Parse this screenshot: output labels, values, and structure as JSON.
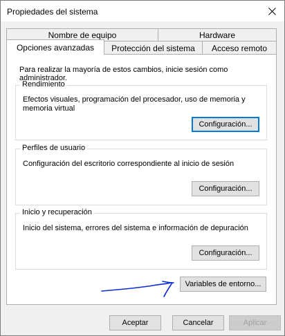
{
  "window": {
    "title": "Propiedades del sistema"
  },
  "tabs": {
    "row1": [
      {
        "label": "Nombre de equipo"
      },
      {
        "label": "Hardware"
      }
    ],
    "row2": [
      {
        "label": "Opciones avanzadas",
        "active": true
      },
      {
        "label": "Protección del sistema"
      },
      {
        "label": "Acceso remoto"
      }
    ]
  },
  "panel": {
    "intro": "Para realizar la mayoría de estos cambios, inicie sesión como administrador.",
    "groups": [
      {
        "label": "Rendimiento",
        "description_line1": "Efectos visuales, programación del procesador, uso de memoria y",
        "description_line2": "memoria virtual",
        "button": "Configuración..."
      },
      {
        "label": "Perfiles de usuario",
        "description_line1": "Configuración del escritorio correspondiente al inicio de sesión",
        "button": "Configuración..."
      },
      {
        "label": "Inicio y recuperación",
        "description_line1": "Inicio del sistema, errores del sistema e información de depuración",
        "button": "Configuración..."
      }
    ],
    "env_button": "Variables de entorno..."
  },
  "footer": {
    "ok": "Aceptar",
    "cancel": "Cancelar",
    "apply": "Aplicar"
  },
  "colors": {
    "focus_border": "#0078d7",
    "annotation_ink": "#0a2ad6"
  }
}
